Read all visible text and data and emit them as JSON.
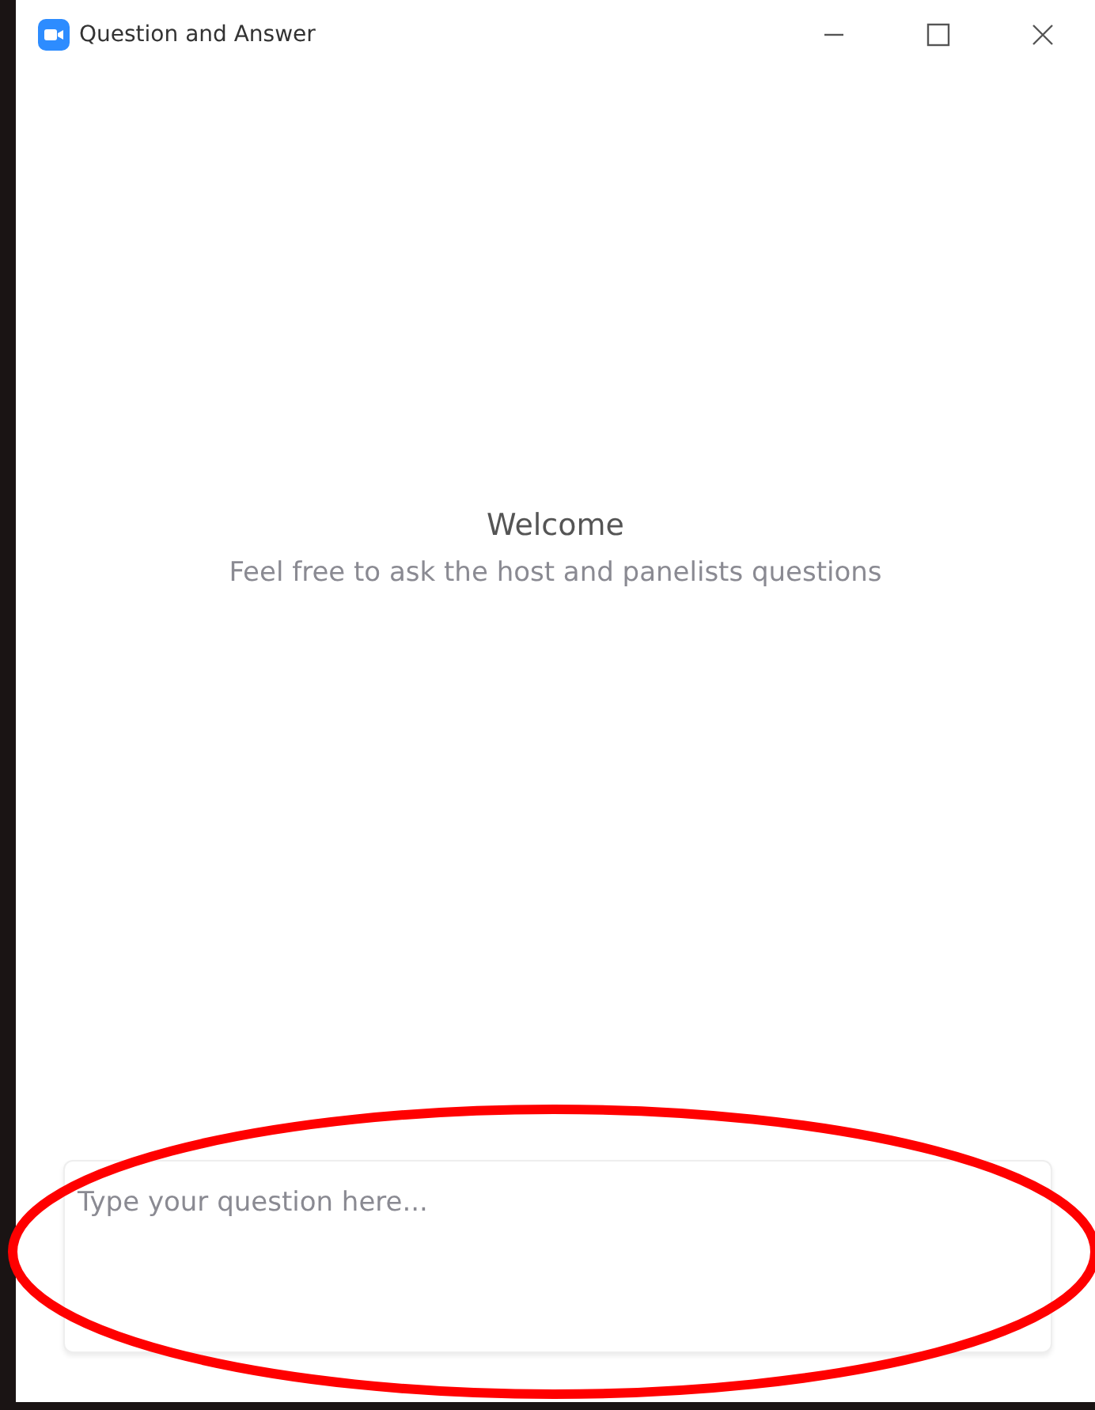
{
  "window": {
    "title": "Question and Answer"
  },
  "welcome": {
    "heading": "Welcome",
    "text": "Feel free to ask the host and panelists questions"
  },
  "question_field": {
    "placeholder": "Type your question here..."
  },
  "annotation": {
    "kind": "ellipse"
  }
}
